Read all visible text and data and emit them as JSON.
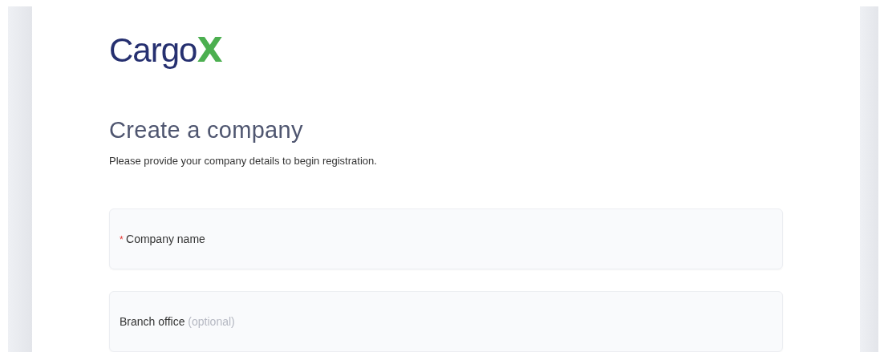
{
  "brand": {
    "name": "Cargo",
    "mark": "X"
  },
  "title": "Create a company",
  "subtitle": "Please provide your company details to begin registration.",
  "fields": [
    {
      "required_mark": "*",
      "label": "Company name"
    },
    {
      "label": "Branch office",
      "note": "(optional)"
    }
  ]
}
